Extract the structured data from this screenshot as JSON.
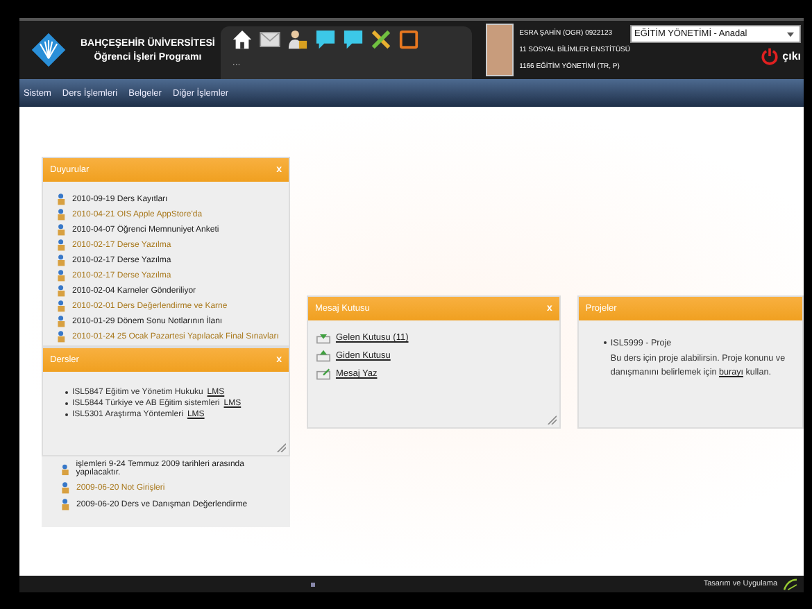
{
  "header": {
    "university": "BAHÇEŞEHİR ÜNİVERSİTESİ",
    "program": "Öğrenci İşleri Programı",
    "tab_text": "...",
    "user": {
      "lines": [
        "ESRA ŞAHİN (OGR) 0922123",
        "11 SOSYAL BİLİMLER ENSTİTÜSÜ",
        "1166 EĞİTİM YÖNETİMİ (TR, P)"
      ]
    },
    "program_select": {
      "value": "EĞİTİM YÖNETİMİ - Anadal"
    },
    "logout": "çıkı"
  },
  "menu": [
    "Sistem",
    "Ders İşlemleri",
    "Belgeler",
    "Diğer İşlemler"
  ],
  "announcements": {
    "title": "Duyurular",
    "close": "x",
    "items": [
      {
        "text": "2010-09-19 Ders Kayıtları",
        "color": "#222222"
      },
      {
        "text": "2010-04-21 OIS Apple AppStore'da",
        "color": "#a8781c"
      },
      {
        "text": "2010-04-07 Öğrenci Memnuniyet Anketi",
        "color": "#222222"
      },
      {
        "text": "2010-02-17 Derse Yazılma",
        "color": "#a8781c"
      },
      {
        "text": "2010-02-17 Derse Yazılma",
        "color": "#222222"
      },
      {
        "text": "2010-02-17 Derse Yazılma",
        "color": "#a8781c"
      },
      {
        "text": "2010-02-04 Karneler Gönderiliyor",
        "color": "#222222"
      },
      {
        "text": "2010-02-01 Ders Değerlendirme ve Karne",
        "color": "#a8781c"
      },
      {
        "text": "2010-01-29 Dönem Sonu Notlarının İlanı",
        "color": "#222222"
      },
      {
        "text": "2010-01-24 25 Ocak Pazartesi Yapılacak Final Sınavları",
        "color": "#a8781c"
      }
    ],
    "more_items": [
      {
        "text": "işlemleri 9-24 Temmuz 2009 tarihleri arasında yapılacaktır.",
        "color": "#222222"
      },
      {
        "text": "2009-06-20 Not Girişleri",
        "color": "#a8781c"
      },
      {
        "text": "2009-06-20 Ders ve Danışman Değerlendirme",
        "color": "#222222"
      }
    ]
  },
  "courses": {
    "title": "Dersler",
    "close": "x",
    "items": [
      {
        "text": "ISL5847 Eğitim ve Yönetim Hukuku",
        "link": "LMS"
      },
      {
        "text": "ISL5844 Türkiye ve AB Eğitim sistemleri",
        "link": "LMS"
      },
      {
        "text": "ISL5301 Araştırma Yöntemleri",
        "link": "LMS"
      }
    ]
  },
  "messages": {
    "title": "Mesaj Kutusu",
    "close": "x",
    "links": [
      {
        "text": "Gelen Kutusu (11)",
        "kind": "inbox"
      },
      {
        "text": "Giden Kutusu",
        "kind": "outbox"
      },
      {
        "text": "Mesaj Yaz",
        "kind": "compose"
      }
    ]
  },
  "projects": {
    "title": "Projeler",
    "items": [
      {
        "title": "ISL5999 - Proje",
        "before": "Bu ders için proje alabilirsin. Proje konunu ve danışmanını belirlemek için",
        "link": "burayı",
        "after": "kullan."
      }
    ]
  },
  "footer": {
    "credit": "Tasarım ve Uygulama"
  }
}
